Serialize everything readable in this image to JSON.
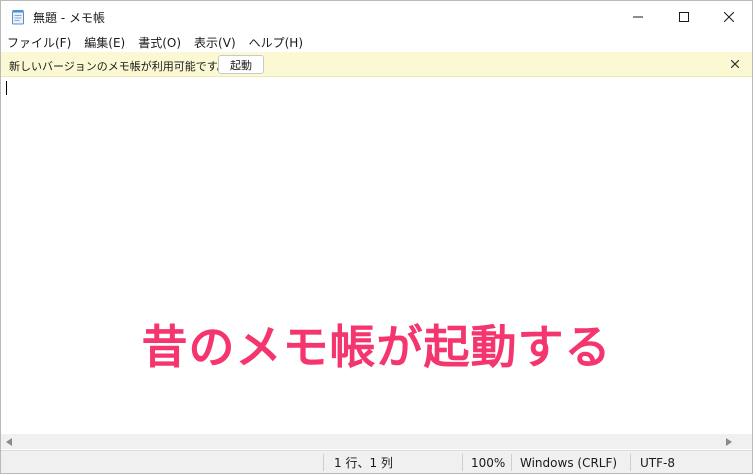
{
  "window": {
    "title": "無題 - メモ帳",
    "icon": "notepad-icon"
  },
  "menu": {
    "items": [
      {
        "label": "ファイル(F)"
      },
      {
        "label": "編集(E)"
      },
      {
        "label": "書式(O)"
      },
      {
        "label": "表示(V)"
      },
      {
        "label": "ヘルプ(H)"
      }
    ]
  },
  "notice": {
    "message": "新しいバージョンのメモ帳が利用可能です。",
    "button_label": "起動",
    "background_color": "#fbf8d4"
  },
  "editor": {
    "content": "",
    "overlay_caption": "昔のメモ帳が起動する",
    "overlay_color": "#f4356e"
  },
  "status": {
    "position": "1 行、1 列",
    "zoom": "100%",
    "line_ending": "Windows (CRLF)",
    "encoding": "UTF-8"
  }
}
